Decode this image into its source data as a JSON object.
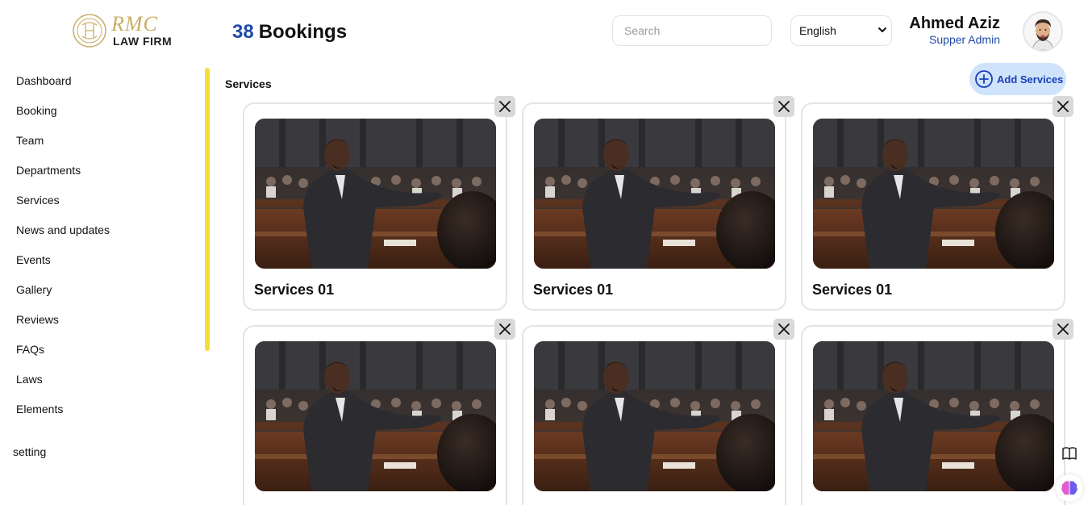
{
  "brand": {
    "monogram": "RMC",
    "name": "LAW FIRM"
  },
  "header": {
    "count": "38",
    "title": "Bookings",
    "search_placeholder": "Search",
    "language": "English",
    "language_options": [
      "English"
    ],
    "user_name": "Ahmed Aziz",
    "user_role": "Supper Admin"
  },
  "sidebar": {
    "items": [
      {
        "label": "Dashboard"
      },
      {
        "label": "Booking"
      },
      {
        "label": "Team"
      },
      {
        "label": "Departments"
      },
      {
        "label": "Services"
      },
      {
        "label": "News and updates"
      },
      {
        "label": "Events"
      },
      {
        "label": "Gallery"
      },
      {
        "label": "Reviews"
      },
      {
        "label": "FAQs"
      },
      {
        "label": "Laws"
      },
      {
        "label": "Elements"
      }
    ],
    "setting_label": "setting"
  },
  "main": {
    "section_title": "Services",
    "add_button_label": "Add Services",
    "cards": [
      {
        "title": "Services 01"
      },
      {
        "title": "Services 01"
      },
      {
        "title": "Services 01"
      },
      {
        "title": ""
      },
      {
        "title": ""
      },
      {
        "title": ""
      }
    ]
  },
  "colors": {
    "accent_blue": "#1f4aa8",
    "add_button_bg": "#cfe3fb",
    "scroll_indicator": "#f6dd3b",
    "logo_gold": "#c9ad66"
  },
  "icons": [
    "logo-emblem",
    "chevron-down-icon",
    "plus-circle-icon",
    "close-icon",
    "book-icon",
    "brain-icon"
  ]
}
